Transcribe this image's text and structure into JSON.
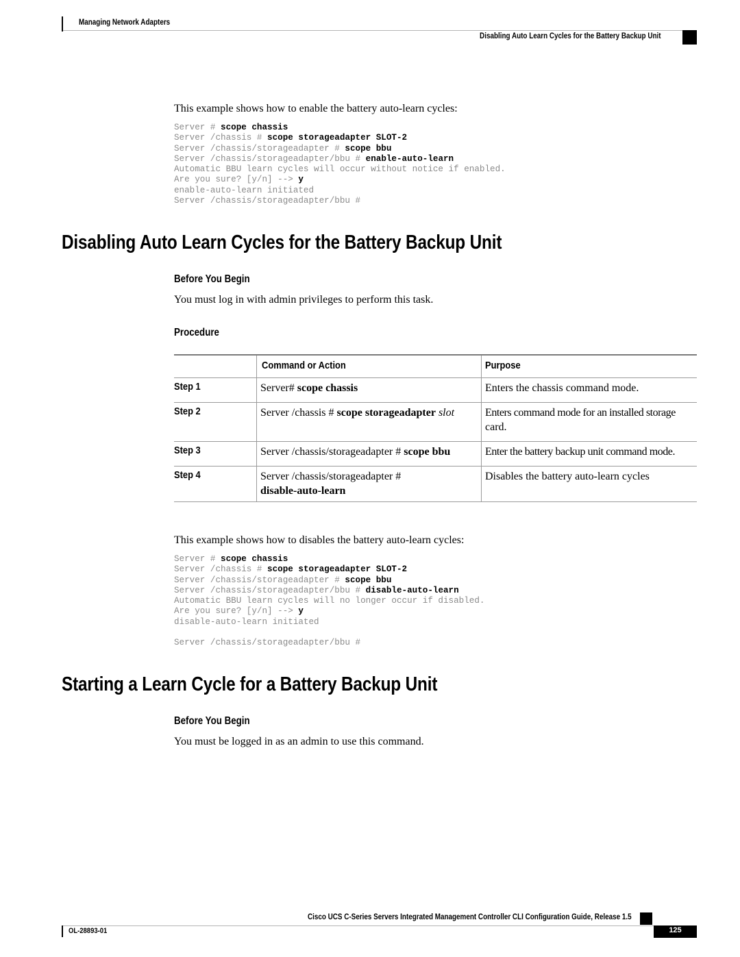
{
  "header": {
    "chapter": "Managing Network Adapters",
    "section": "Disabling Auto Learn Cycles for the Battery Backup Unit"
  },
  "enable_example": {
    "intro": "This example shows how to enable the battery auto-learn cycles:",
    "lines": [
      {
        "prompt": "Server # ",
        "cmd": "scope chassis"
      },
      {
        "prompt": "Server /chassis # ",
        "cmd": "scope storageadapter SLOT-2"
      },
      {
        "prompt": "Server /chassis/storageadapter # ",
        "cmd": "scope bbu"
      },
      {
        "prompt": "Server /chassis/storageadapter/bbu # ",
        "cmd": "enable-auto-learn"
      },
      {
        "prompt": "Automatic BBU learn cycles will occur without notice if enabled.",
        "cmd": ""
      },
      {
        "prompt": "Are you sure? [y/n] --> ",
        "cmd": "y"
      },
      {
        "prompt": "enable-auto-learn initiated",
        "cmd": ""
      },
      {
        "prompt": "Server /chassis/storageadapter/bbu #",
        "cmd": ""
      }
    ]
  },
  "section_disable": {
    "title": "Disabling Auto Learn Cycles for the Battery Backup Unit",
    "before_heading": "Before You Begin",
    "before_text": "You must log in with admin privileges to perform this task.",
    "procedure_heading": "Procedure",
    "table": {
      "headers": [
        "",
        "Command or Action",
        "Purpose"
      ],
      "rows": [
        {
          "step": "Step 1",
          "cmd_prefix": "Server# ",
          "cmd_bold": "scope chassis",
          "cmd_italic": "",
          "cmd_second_line": "",
          "purpose": "Enters the chassis command mode.",
          "purpose_second_line": ""
        },
        {
          "step": "Step 2",
          "cmd_prefix": "Server /chassis # ",
          "cmd_bold": "scope storageadapter",
          "cmd_italic": " slot",
          "cmd_second_line": "",
          "purpose": "Enters command mode for an installed storage",
          "purpose_second_line": "card."
        },
        {
          "step": "Step 3",
          "cmd_prefix": "Server /chassis/storageadapter # ",
          "cmd_bold": "scope bbu",
          "cmd_italic": "",
          "cmd_second_line": "",
          "purpose": "Enter the battery backup unit command mode.",
          "purpose_second_line": ""
        },
        {
          "step": "Step 4",
          "cmd_prefix": "Server /chassis/storageadapter #",
          "cmd_bold": "",
          "cmd_italic": "",
          "cmd_second_line": "disable-auto-learn",
          "purpose": "Disables the battery auto-learn cycles",
          "purpose_second_line": ""
        }
      ]
    }
  },
  "disable_example": {
    "intro": "This example shows how to disables the battery auto-learn cycles:",
    "lines": [
      {
        "prompt": "Server # ",
        "cmd": "scope chassis"
      },
      {
        "prompt": "Server /chassis # ",
        "cmd": "scope storageadapter SLOT-2"
      },
      {
        "prompt": "Server /chassis/storageadapter # ",
        "cmd": "scope bbu"
      },
      {
        "prompt": "Server /chassis/storageadapter/bbu # ",
        "cmd": "disable-auto-learn"
      },
      {
        "prompt": "Automatic BBU learn cycles will no longer occur if disabled.",
        "cmd": ""
      },
      {
        "prompt": "Are you sure? [y/n] --> ",
        "cmd": "y"
      },
      {
        "prompt": "disable-auto-learn initiated",
        "cmd": ""
      },
      {
        "prompt": "",
        "cmd": ""
      },
      {
        "prompt": "Server /chassis/storageadapter/bbu #",
        "cmd": ""
      }
    ]
  },
  "section_start": {
    "title": "Starting a Learn Cycle for a Battery Backup Unit",
    "before_heading": "Before You Begin",
    "before_text": "You must be logged in as an admin to use this command."
  },
  "footer": {
    "guide_title": "Cisco UCS C-Series Servers Integrated Management Controller CLI Configuration Guide, Release 1.5",
    "doc_number": "OL-28893-01",
    "page_number": "125"
  }
}
